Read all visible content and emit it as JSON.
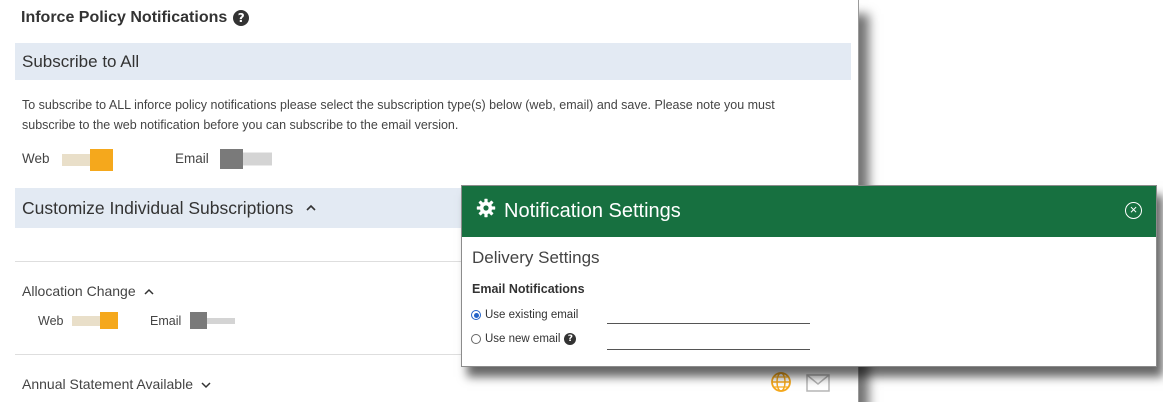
{
  "page": {
    "title": "Inforce Policy Notifications",
    "subscribe_all": {
      "heading": "Subscribe to All",
      "description": "To subscribe to ALL inforce policy notifications please select the subscription type(s) below (web, email) and save. Please note you must subscribe to the web notification before you can subscribe to the email version.",
      "web_label": "Web",
      "web_on": true,
      "email_label": "Email",
      "email_on": false
    },
    "customize": {
      "heading": "Customize Individual Subscriptions",
      "chevron": "^",
      "items": [
        {
          "label": "Allocation Change",
          "chevron": "^",
          "web_label": "Web",
          "web_on": true,
          "email_label": "Email",
          "email_on": false
        },
        {
          "label": "Annual Statement Available",
          "chevron": "˅"
        }
      ]
    }
  },
  "modal": {
    "title": "Notification Settings",
    "section": "Delivery Settings",
    "subsection": "Email Notifications",
    "options": [
      {
        "label": "Use existing email",
        "checked": true,
        "value": ""
      },
      {
        "label": "Use new email",
        "checked": false,
        "value": ""
      }
    ]
  },
  "colors": {
    "accent_orange": "#f5a81c",
    "modal_green": "#177040",
    "band_blue": "#e3eaf3",
    "toggle_off": "#7a7a7a"
  },
  "icons": [
    "help-circle-icon",
    "gear-icon",
    "close-circle-icon",
    "chevron-up-icon",
    "chevron-down-icon",
    "globe-icon",
    "mail-icon"
  ]
}
